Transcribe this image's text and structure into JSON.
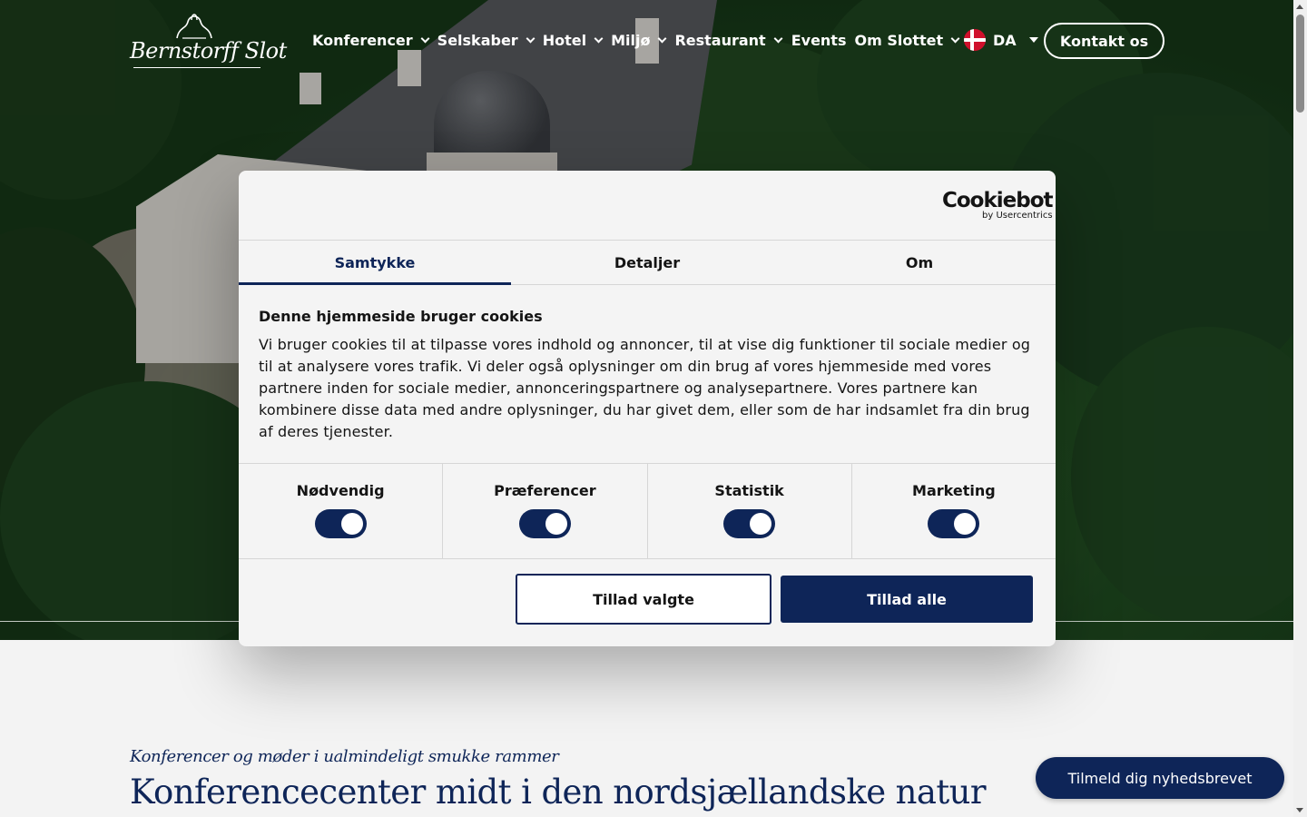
{
  "header": {
    "logo_text": "Bernstorff Slot",
    "nav": [
      {
        "label": "Konferencer",
        "dropdown": true
      },
      {
        "label": "Selskaber",
        "dropdown": true
      },
      {
        "label": "Hotel",
        "dropdown": true
      },
      {
        "label": "Miljø",
        "dropdown": true
      },
      {
        "label": "Restaurant",
        "dropdown": true
      },
      {
        "label": "Events",
        "dropdown": false
      },
      {
        "label": "Om Slottet",
        "dropdown": true
      }
    ],
    "language": {
      "code": "DA",
      "flag": "denmark-flag-icon"
    },
    "contact_label": "Kontakt os"
  },
  "cookie_dialog": {
    "brand": {
      "name": "Cookiebot",
      "sub": "by Usercentrics"
    },
    "tabs": [
      {
        "label": "Samtykke",
        "active": true
      },
      {
        "label": "Detaljer",
        "active": false
      },
      {
        "label": "Om",
        "active": false
      }
    ],
    "title": "Denne hjemmeside bruger cookies",
    "text": "Vi bruger cookies til at tilpasse vores indhold og annoncer, til at vise dig funktioner til sociale medier og til at analysere vores trafik. Vi deler også oplysninger om din brug af vores hjemmeside med vores partnere inden for sociale medier, annonceringspartnere og analysepartnere. Vores partnere kan kombinere disse data med andre oplysninger, du har givet dem, eller som de har indsamlet fra din brug af deres tjenester.",
    "categories": [
      {
        "label": "Nødvendig",
        "enabled": true
      },
      {
        "label": "Præferencer",
        "enabled": true
      },
      {
        "label": "Statistik",
        "enabled": true
      },
      {
        "label": "Marketing",
        "enabled": true
      }
    ],
    "allow_selected_label": "Tillad valgte",
    "allow_all_label": "Tillad alle"
  },
  "main": {
    "tagline": "Konferencer og møder i ualmindeligt smukke rammer",
    "headline": "Konferencecenter midt i den nordsjællandske natur"
  },
  "newsletter_label": "Tilmeld dig nyhedsbrevet",
  "colors": {
    "primary": "#0e2558",
    "dialog_bg": "#f4f4f4",
    "hero_green": "#2f6a2d"
  }
}
